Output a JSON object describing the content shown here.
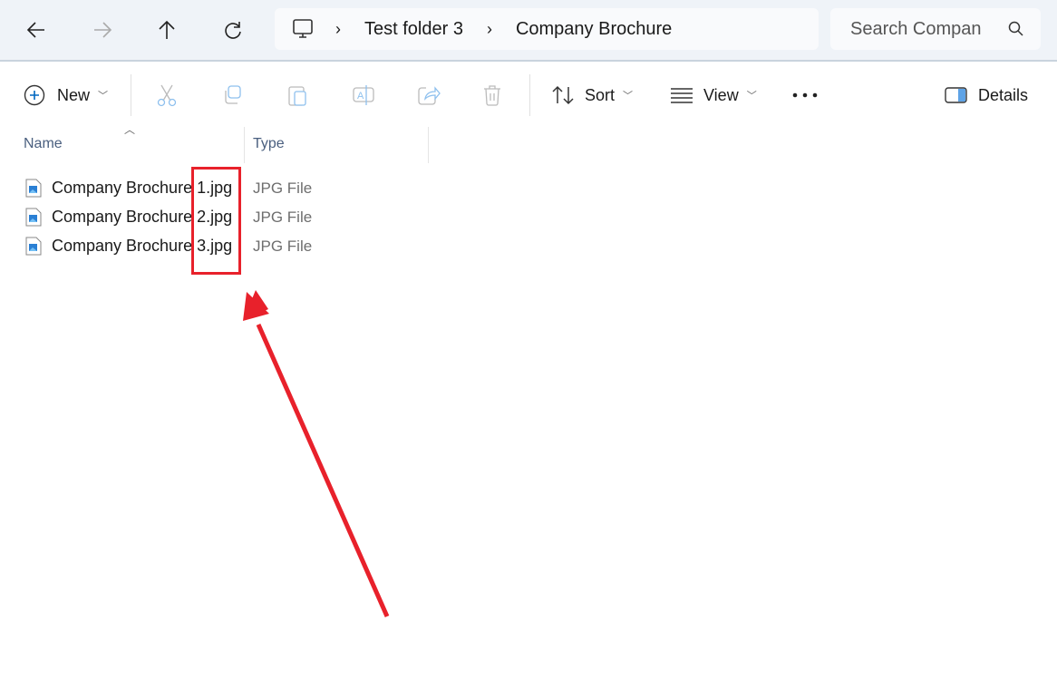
{
  "nav": {
    "back": "back",
    "forward": "forward",
    "up": "up",
    "refresh": "refresh"
  },
  "breadcrumb": [
    "Test folder 3",
    "Company Brochure"
  ],
  "search": {
    "placeholder": "Search Compan"
  },
  "toolbar": {
    "new_label": "New",
    "sort_label": "Sort",
    "view_label": "View",
    "details_label": "Details"
  },
  "columns": {
    "name": "Name",
    "type": "Type"
  },
  "files": [
    {
      "name": "Company Brochure 1.jpg",
      "type": "JPG File"
    },
    {
      "name": "Company Brochure 2.jpg",
      "type": "JPG File"
    },
    {
      "name": "Company Brochure 3.jpg",
      "type": "JPG File"
    }
  ],
  "annotation_color": "#e8212b"
}
